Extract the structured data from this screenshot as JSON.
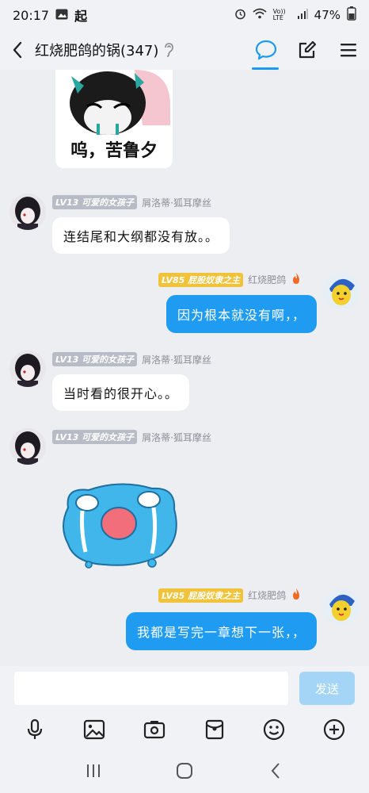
{
  "status_bar": {
    "time": "20:17",
    "carrier_glyph": "起",
    "network": "Vo)) LTE",
    "battery": "47%"
  },
  "header": {
    "title": "红烧肥鸽的锅(347)"
  },
  "top_sticker": {
    "caption": "呜，苦鲁夕"
  },
  "messages": [
    {
      "badge": "LV13 可爱的女孩子",
      "sender": "屑洛蒂·狐耳摩丝",
      "text": "连结尾和大纲都没有放。。"
    },
    {
      "badge": "LV85 屁股奴隶之主",
      "sender": "红烧肥鸽",
      "text": "因为根本就没有啊，，"
    },
    {
      "badge": "LV13 可爱的女孩子",
      "sender": "屑洛蒂·狐耳摩丝",
      "text": "当时看的很开心。。"
    },
    {
      "badge": "LV13 可爱的女孩子",
      "sender": "屑洛蒂·狐耳摩丝",
      "sticker": "crying-blue-blob-sticker"
    },
    {
      "badge": "LV85 屁股奴隶之主",
      "sender": "红烧肥鸽",
      "text": "我都是写完一章想下一张，，"
    }
  ],
  "input": {
    "value": "",
    "send_label": "发送"
  },
  "toolbar": [
    "microphone-icon",
    "image-icon",
    "camera-icon",
    "red-packet-icon",
    "emoji-icon",
    "plus-icon"
  ],
  "colors": {
    "accent": "#1f9cf2",
    "background": "#eceef2",
    "badge_gray": "#b8bcc6",
    "badge_gold": "#f0c33a"
  }
}
